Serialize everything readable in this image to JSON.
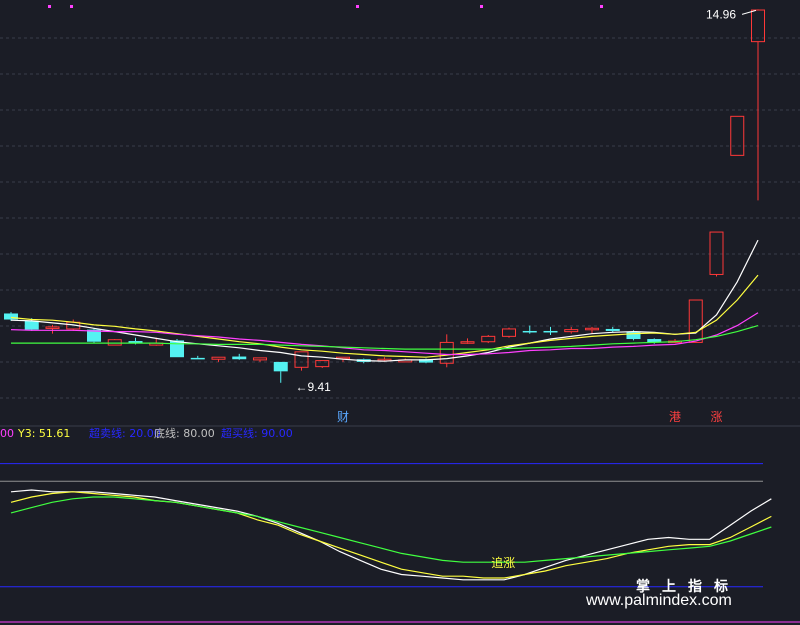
{
  "chart_data": {
    "type": "candlestick",
    "price_labels": {
      "high": "14.96",
      "low": "9.41"
    },
    "event_markers": [
      {
        "text": "财",
        "index": 16,
        "color": "#5aa8ff"
      },
      {
        "text": "港",
        "index": 32,
        "color": "#ff4040"
      },
      {
        "text": "涨",
        "index": 34,
        "color": "#ff4040"
      }
    ],
    "candles": [
      {
        "o": 10.44,
        "c": 10.35,
        "h": 10.46,
        "l": 10.33
      },
      {
        "o": 10.33,
        "c": 10.2,
        "h": 10.37,
        "l": 10.18
      },
      {
        "o": 10.22,
        "c": 10.24,
        "h": 10.27,
        "l": 10.14
      },
      {
        "o": 10.21,
        "c": 10.31,
        "h": 10.35,
        "l": 10.18
      },
      {
        "o": 10.2,
        "c": 10.02,
        "h": 10.22,
        "l": 10.0
      },
      {
        "o": 9.97,
        "c": 10.05,
        "h": 10.06,
        "l": 9.97
      },
      {
        "o": 10.03,
        "c": 10.0,
        "h": 10.08,
        "l": 9.98
      },
      {
        "o": 9.97,
        "c": 10.0,
        "h": 10.08,
        "l": 9.96
      },
      {
        "o": 10.04,
        "c": 9.79,
        "h": 10.06,
        "l": 9.79
      },
      {
        "o": 9.78,
        "c": 9.76,
        "h": 9.81,
        "l": 9.76
      },
      {
        "o": 9.76,
        "c": 9.79,
        "h": 9.79,
        "l": 9.72
      },
      {
        "o": 9.8,
        "c": 9.76,
        "h": 9.84,
        "l": 9.75
      },
      {
        "o": 9.75,
        "c": 9.78,
        "h": 9.78,
        "l": 9.72
      },
      {
        "o": 9.72,
        "c": 9.58,
        "h": 9.72,
        "l": 9.41
      },
      {
        "o": 9.64,
        "c": 9.87,
        "h": 9.87,
        "l": 9.59
      },
      {
        "o": 9.65,
        "c": 9.74,
        "h": 9.74,
        "l": 9.63
      },
      {
        "o": 9.77,
        "c": 9.79,
        "h": 9.79,
        "l": 9.72
      },
      {
        "o": 9.76,
        "c": 9.72,
        "h": 9.77,
        "l": 9.7
      },
      {
        "o": 9.75,
        "c": 9.76,
        "h": 9.79,
        "l": 9.73
      },
      {
        "o": 9.72,
        "c": 9.75,
        "h": 9.77,
        "l": 9.72
      },
      {
        "o": 9.76,
        "c": 9.71,
        "h": 9.77,
        "l": 9.7
      },
      {
        "o": 9.7,
        "c": 10.01,
        "h": 10.13,
        "l": 9.64
      },
      {
        "o": 10.01,
        "c": 10.02,
        "h": 10.07,
        "l": 9.99
      },
      {
        "o": 10.02,
        "c": 10.1,
        "h": 10.12,
        "l": 10.0
      },
      {
        "o": 10.1,
        "c": 10.21,
        "h": 10.23,
        "l": 10.08
      },
      {
        "o": 10.18,
        "c": 10.17,
        "h": 10.26,
        "l": 10.14
      },
      {
        "o": 10.18,
        "c": 10.17,
        "h": 10.24,
        "l": 10.12
      },
      {
        "o": 10.17,
        "c": 10.2,
        "h": 10.24,
        "l": 10.14
      },
      {
        "o": 10.2,
        "c": 10.22,
        "h": 10.24,
        "l": 10.14
      },
      {
        "o": 10.21,
        "c": 10.18,
        "h": 10.24,
        "l": 10.16
      },
      {
        "o": 10.17,
        "c": 10.06,
        "h": 10.19,
        "l": 10.04
      },
      {
        "o": 10.06,
        "c": 10.01,
        "h": 10.07,
        "l": 9.99
      },
      {
        "o": 10.02,
        "c": 10.03,
        "h": 10.06,
        "l": 10.0
      },
      {
        "o": 10.01,
        "c": 10.64,
        "h": 10.64,
        "l": 10.01
      },
      {
        "o": 11.02,
        "c": 11.65,
        "h": 11.65,
        "l": 10.99
      },
      {
        "o": 12.79,
        "c": 13.37,
        "h": 13.37,
        "l": 12.79
      },
      {
        "o": 14.48,
        "c": 14.95,
        "h": 14.96,
        "l": 12.12
      }
    ],
    "ma": [
      {
        "color": "#ffffff",
        "values": [
          10.34,
          10.33,
          10.3,
          10.27,
          10.22,
          10.17,
          10.12,
          10.07,
          10.02,
          9.99,
          9.96,
          9.93,
          9.89,
          9.86,
          9.81,
          9.79,
          9.76,
          9.74,
          9.73,
          9.75,
          9.75,
          9.77,
          9.81,
          9.86,
          9.94,
          10.0,
          10.06,
          10.1,
          10.14,
          10.16,
          10.17,
          10.16,
          10.13,
          10.15,
          10.42,
          10.91,
          11.53
        ]
      },
      {
        "color": "#ffff40",
        "values": [
          10.38,
          10.35,
          10.34,
          10.31,
          10.27,
          10.25,
          10.21,
          10.18,
          10.14,
          10.1,
          10.06,
          10.02,
          9.99,
          9.94,
          9.9,
          9.88,
          9.85,
          9.83,
          9.81,
          9.8,
          9.79,
          9.82,
          9.86,
          9.9,
          9.96,
          10.0,
          10.04,
          10.07,
          10.1,
          10.12,
          10.14,
          10.15,
          10.13,
          10.16,
          10.34,
          10.64,
          11.01
        ]
      },
      {
        "color": "#ff40ff",
        "values": [
          10.2,
          10.19,
          10.19,
          10.19,
          10.18,
          10.17,
          10.17,
          10.16,
          10.13,
          10.11,
          10.09,
          10.06,
          10.04,
          10.01,
          9.98,
          9.96,
          9.93,
          9.9,
          9.89,
          9.87,
          9.85,
          9.83,
          9.83,
          9.84,
          9.86,
          9.89,
          9.9,
          9.92,
          9.92,
          9.94,
          9.95,
          9.97,
          9.98,
          10.03,
          10.12,
          10.26,
          10.45
        ]
      },
      {
        "color": "#40ff40",
        "values": [
          10.0,
          10.0,
          10.0,
          10.0,
          10.0,
          10.0,
          10.0,
          10.0,
          9.99,
          9.99,
          9.98,
          9.98,
          9.98,
          9.97,
          9.96,
          9.95,
          9.94,
          9.93,
          9.92,
          9.91,
          9.91,
          9.91,
          9.91,
          9.91,
          9.92,
          9.93,
          9.94,
          9.95,
          9.97,
          9.99,
          10.0,
          10.01,
          10.02,
          10.05,
          10.1,
          10.17,
          10.26
        ]
      }
    ],
    "oscillator": {
      "legend": [
        {
          "text": "00",
          "color": "#ff40ff"
        },
        {
          "text": "Y3: 51.61",
          "color": "#ffff40"
        },
        {
          "text": "超卖线: 20.00",
          "color": "#2828ff"
        },
        {
          "text": "底线: 80.00",
          "color": "#c0c0c0"
        },
        {
          "text": "超买线: 90.00",
          "color": "#2828ff"
        }
      ],
      "annotation": {
        "text": "追涨",
        "index": 24,
        "color": "#ffff40"
      },
      "ylim": [
        0,
        100
      ],
      "hlines": [
        {
          "value": 90,
          "color": "#2828ff"
        },
        {
          "value": 80,
          "color": "#909090"
        },
        {
          "value": 20,
          "color": "#2828ff"
        },
        {
          "value": 0,
          "color": "#ff40ff"
        }
      ],
      "series": [
        {
          "color": "#ffffff",
          "values": [
            74,
            75,
            74,
            74,
            74,
            73,
            72,
            71,
            69,
            67,
            65,
            63,
            60,
            56,
            51,
            46,
            40,
            35,
            30,
            27,
            26,
            25,
            24,
            24,
            24,
            27,
            31,
            35,
            38,
            41,
            44,
            47,
            48,
            47,
            47,
            55,
            63,
            70
          ]
        },
        {
          "color": "#ffff40",
          "values": [
            68,
            71,
            73,
            74,
            73,
            72,
            71,
            69,
            68,
            66,
            64,
            62,
            58,
            55,
            50,
            46,
            42,
            38,
            34,
            30,
            28,
            26,
            26,
            25,
            25,
            27,
            29,
            32,
            34,
            36,
            39,
            41,
            43,
            44,
            44,
            48,
            54,
            60
          ]
        },
        {
          "color": "#40ff40",
          "values": [
            62,
            65,
            68,
            70,
            71,
            71,
            70,
            69,
            68,
            66,
            64,
            62,
            60,
            57,
            54,
            51,
            48,
            45,
            42,
            39,
            37,
            35,
            34,
            34,
            34,
            34,
            35,
            36,
            37,
            38,
            39,
            40,
            41,
            42,
            43,
            46,
            50,
            54
          ]
        }
      ]
    }
  },
  "watermark": {
    "chinese": "掌上指标",
    "url": "www.palmindex.com"
  }
}
